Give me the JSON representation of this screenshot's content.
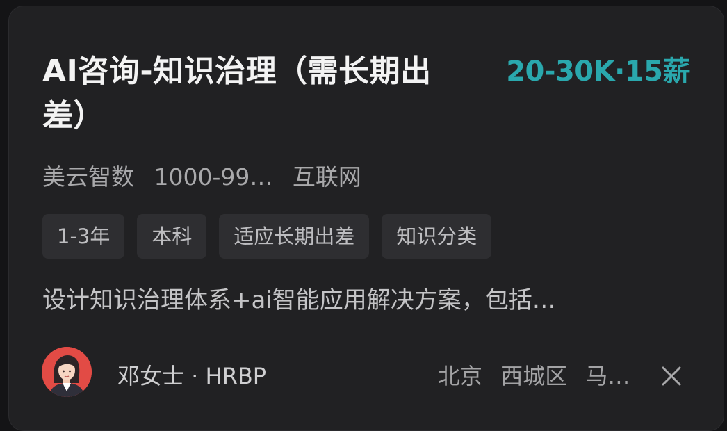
{
  "job": {
    "title": "AI咨询-知识治理（需长期出差）",
    "salary": "20-30K·15薪",
    "company": {
      "name": "美云智数",
      "size": "1000-99…",
      "industry": "互联网"
    },
    "tags": [
      "1-3年",
      "本科",
      "适应长期出差",
      "知识分类"
    ],
    "description": "设计知识治理体系+ai智能应用解决方案，包括…"
  },
  "recruiter": {
    "name_title": "邓女士 · HRBP",
    "avatar_icon": "avatar-woman-icon"
  },
  "location": {
    "city": "北京",
    "district": "西城区",
    "area": "马…"
  },
  "actions": {
    "close_icon": "close-icon"
  },
  "colors": {
    "background": "#141416",
    "card": "#212123",
    "salary": "#2aa8ad",
    "tag_bg": "#2e2e31",
    "avatar_bg": "#e24b45"
  }
}
